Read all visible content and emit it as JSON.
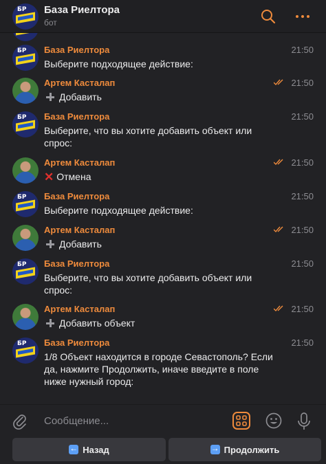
{
  "header": {
    "title": "База Риелтора",
    "subtitle": "бот"
  },
  "bot_avatar": {
    "label": "БР"
  },
  "messages": [
    {
      "author": "База Риелтора",
      "time": "21:50",
      "text": "Выберите подходящее действие:",
      "type": "bot"
    },
    {
      "author": "Артем Касталап",
      "time": "21:50",
      "text": "Добавить",
      "type": "user",
      "icon": "plus-icon"
    },
    {
      "author": "База Риелтора",
      "time": "21:50",
      "text": "Выберите, что вы хотите добавить объект или спрос:",
      "type": "bot"
    },
    {
      "author": "Артем Касталап",
      "time": "21:50",
      "text": "Отмена",
      "type": "user",
      "icon": "cross-icon"
    },
    {
      "author": "База Риелтора",
      "time": "21:50",
      "text": "Выберите подходящее действие:",
      "type": "bot"
    },
    {
      "author": "Артем Касталап",
      "time": "21:50",
      "text": "Добавить",
      "type": "user",
      "icon": "plus-icon"
    },
    {
      "author": "База Риелтора",
      "time": "21:50",
      "text": "Выберите, что вы хотите добавить объект или спрос:",
      "type": "bot"
    },
    {
      "author": "Артем Касталап",
      "time": "21:50",
      "text": "Добавить объект",
      "type": "user",
      "icon": "plus-icon"
    },
    {
      "author": "База Риелтора",
      "time": "21:50",
      "text": "1/8 Объект находится в городе Севастополь? Если да, нажмите Продолжить, иначе введите в поле ниже нужный город:",
      "type": "bot"
    }
  ],
  "composer": {
    "placeholder": "Сообщение..."
  },
  "keyboard": {
    "back_label": "Назад",
    "next_label": "Продолжить"
  },
  "colors": {
    "author_accent": "#ef8b3c",
    "background": "#222225",
    "button": "#38383d",
    "check_ticks": "#ef8b3c"
  }
}
